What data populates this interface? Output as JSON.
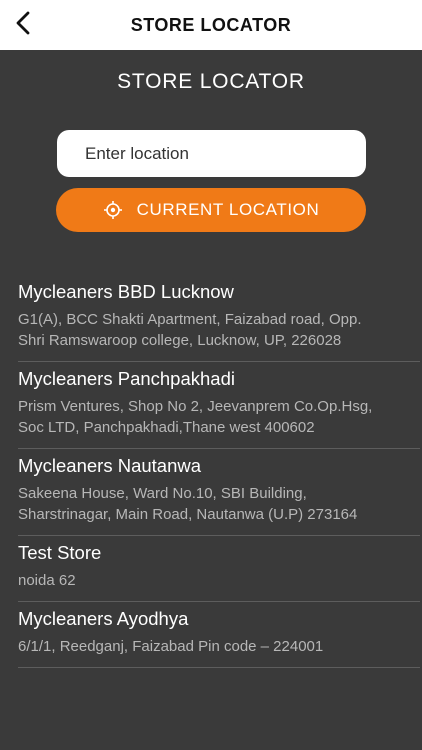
{
  "header": {
    "back_icon": "chevron-left-icon",
    "title": "STORE LOCATOR"
  },
  "main": {
    "section_title": "STORE LOCATOR",
    "search": {
      "placeholder": "Enter location",
      "value": ""
    },
    "current_location": {
      "icon": "crosshair-target-icon",
      "label": "CURRENT LOCATION"
    }
  },
  "stores": [
    {
      "name": "Mycleaners BBD Lucknow",
      "address": "G1(A), BCC Shakti Apartment, Faizabad road, Opp. Shri Ramswaroop college, Lucknow, UP, 226028"
    },
    {
      "name": "Mycleaners Panchpakhadi",
      "address": "Prism Ventures, Shop No 2, Jeevanprem Co.Op.Hsg, Soc LTD, Panchpakhadi,Thane west 400602"
    },
    {
      "name": "Mycleaners Nautanwa",
      "address": "Sakeena House, Ward No.10, SBI Building, Sharstrinagar, Main Road, Nautanwa (U.P) 273164"
    },
    {
      "name": "Test Store",
      "address": "noida 62"
    },
    {
      "name": "Mycleaners Ayodhya",
      "address": "6/1/1, Reedganj, Faizabad Pin code – 224001"
    }
  ],
  "colors": {
    "accent": "#f07a17",
    "background": "#3a3a3a",
    "header_bg": "#ffffff"
  }
}
